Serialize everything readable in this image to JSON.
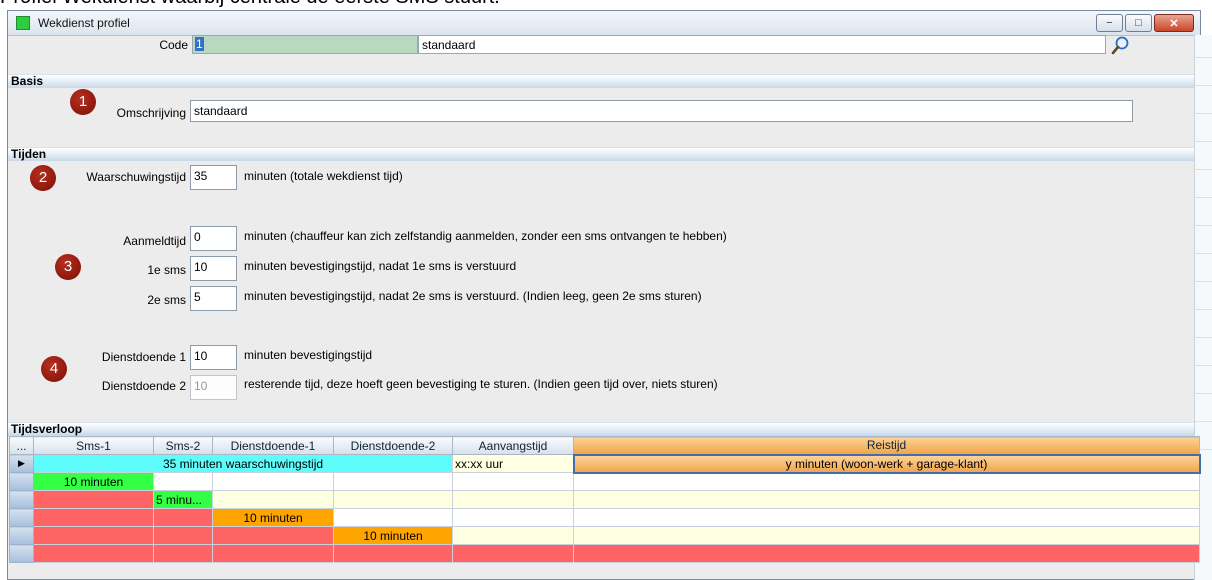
{
  "page_caption": "Profiel Wekdienst waarbij centrale de eerste SMS stuurt.",
  "window": {
    "title": "Wekdienst profiel",
    "controls": [
      "minimize-icon",
      "maximize-icon",
      "close-icon"
    ]
  },
  "code": {
    "label": "Code",
    "value": "1",
    "description": "standaard",
    "search_icon": "search-icon"
  },
  "sections": {
    "basis": "Basis",
    "tijden": "Tijden",
    "tijdsverloop": "Tijdsverloop"
  },
  "badges": [
    "1",
    "2",
    "3",
    "4"
  ],
  "basis": {
    "omschrijving_label": "Omschrijving",
    "omschrijving_value": "standaard"
  },
  "tijden": {
    "waarschuwing": {
      "label": "Waarschuwingstijd",
      "value": "35",
      "hint": "minuten (totale wekdienst tijd)"
    },
    "aanmeld": {
      "label": "Aanmeldtijd",
      "value": "0",
      "hint": "minuten (chauffeur kan zich zelfstandig aanmelden, zonder een sms ontvangen te hebben)"
    },
    "sms1": {
      "label": "1e sms",
      "value": "10",
      "hint": "minuten bevestigingstijd, nadat 1e sms is verstuurd"
    },
    "sms2": {
      "label": "2e sms",
      "value": "5",
      "hint": "minuten bevestigingstijd, nadat 2e sms is verstuurd. (Indien leeg, geen 2e sms sturen)"
    },
    "dienst1": {
      "label": "Dienstdoende 1",
      "value": "10",
      "hint": "minuten bevestigingstijd"
    },
    "dienst2": {
      "label": "Dienstdoende 2",
      "value": "10",
      "hint": "resterende tijd, deze hoeft geen bevestiging te sturen. (Indien geen tijd over, niets sturen)"
    }
  },
  "grid": {
    "corner": "...",
    "columns": [
      "Sms-1",
      "Sms-2",
      "Dienstdoende-1",
      "Dienstdoende-2",
      "Aanvangstijd",
      "Reistijd"
    ],
    "current_row_marker": "▶",
    "row1": {
      "span_text": "35 minuten waarschuwingstijd",
      "aanvang": "xx:xx uur",
      "reistijd": "y minuten (woon-werk + garage-klant)"
    },
    "row2": {
      "sms1": "10 minuten"
    },
    "row3": {
      "sms2": "5 minu..."
    },
    "row4": {
      "dienst1": "10 minuten"
    },
    "row5": {
      "dienst2": "10 minuten"
    }
  },
  "colors": {
    "cyan": "#5ffcfc",
    "green": "#33ff44",
    "red": "#ff6464",
    "orange": "#ffa500",
    "badge": "#8b1408"
  }
}
